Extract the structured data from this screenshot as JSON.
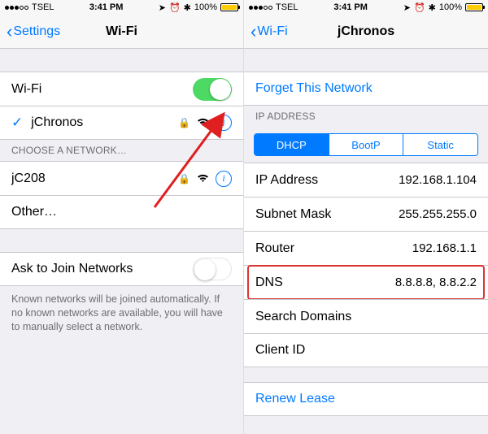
{
  "status": {
    "carrier": "TSEL",
    "time": "3:41 PM",
    "battery_pct": "100%"
  },
  "left": {
    "back_label": "Settings",
    "title": "Wi-Fi",
    "wifi_row": "Wi-Fi",
    "connected_network": "jChronos",
    "choose_header": "CHOOSE A NETWORK…",
    "other_network": "jC208",
    "other_label": "Other…",
    "ask_label": "Ask to Join Networks",
    "ask_note": "Known networks will be joined automatically. If no known networks are available, you will have to manually select a network."
  },
  "right": {
    "back_label": "Wi-Fi",
    "title": "jChronos",
    "forget": "Forget This Network",
    "ip_header": "IP ADDRESS",
    "seg": {
      "dhcp": "DHCP",
      "bootp": "BootP",
      "static": "Static"
    },
    "rows": {
      "ip_label": "IP Address",
      "ip_value": "192.168.1.104",
      "subnet_label": "Subnet Mask",
      "subnet_value": "255.255.255.0",
      "router_label": "Router",
      "router_value": "192.168.1.1",
      "dns_label": "DNS",
      "dns_value": "8.8.8.8, 8.8.2.2",
      "search_label": "Search Domains",
      "client_label": "Client ID"
    },
    "renew": "Renew Lease"
  }
}
